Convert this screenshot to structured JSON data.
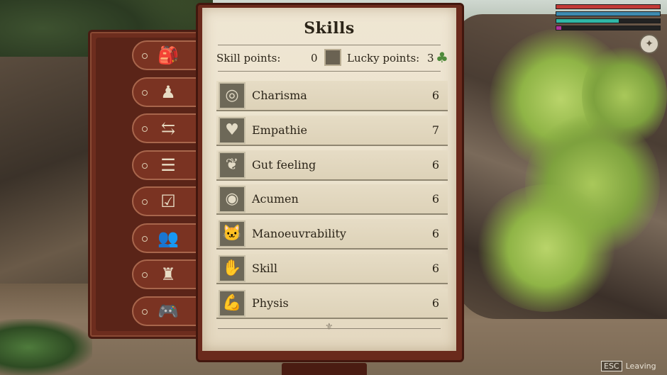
{
  "colors": {
    "health": "#c23a36",
    "stamina": "#3e8bb0",
    "energy": "#2fb7a6",
    "nourishment": "#b0319e",
    "paper": "#ebe2cd",
    "leather": "#6a2a1c"
  },
  "hud": {
    "bars": [
      {
        "name": "health-bar",
        "fill": 1.0
      },
      {
        "name": "stamina-bar",
        "fill": 1.0
      },
      {
        "name": "energy-bar",
        "fill": 0.6
      },
      {
        "name": "nourishment-bar",
        "fill": 0.05
      }
    ],
    "compass_icon": "compass-icon"
  },
  "tabs": [
    {
      "icon": "backpack-icon",
      "glyph": "🎒"
    },
    {
      "icon": "character-icon",
      "glyph": "♟"
    },
    {
      "icon": "signpost-icon",
      "glyph": "⇆"
    },
    {
      "icon": "checklist-icon",
      "glyph": "☰"
    },
    {
      "icon": "quest-checkmark-icon",
      "glyph": "☑"
    },
    {
      "icon": "group-icon",
      "glyph": "👥"
    },
    {
      "icon": "chef-icon",
      "glyph": "♜"
    },
    {
      "icon": "gamepad-icon",
      "glyph": "🎮"
    }
  ],
  "skills_panel": {
    "title": "Skills",
    "skill_points_label": "Skill points:",
    "skill_points_value": "0",
    "lucky_points_label": "Lucky points:",
    "lucky_points_value": "3",
    "skills": [
      {
        "name": "Charisma",
        "value": "6",
        "icon": "charisma-icon",
        "glyph": "◎"
      },
      {
        "name": "Empathie",
        "value": "7",
        "icon": "heart-icon",
        "glyph": "♥"
      },
      {
        "name": "Gut feeling",
        "value": "6",
        "icon": "stomach-icon",
        "glyph": "❦"
      },
      {
        "name": "Acumen",
        "value": "6",
        "icon": "eye-icon",
        "glyph": "◉"
      },
      {
        "name": "Manoeuvrability",
        "value": "6",
        "icon": "cat-icon",
        "glyph": "🐱"
      },
      {
        "name": "Skill",
        "value": "6",
        "icon": "hand-icon",
        "glyph": "✋"
      },
      {
        "name": "Physis",
        "value": "6",
        "icon": "muscle-icon",
        "glyph": "💪"
      }
    ]
  },
  "footer": {
    "esc_key": "ESC",
    "esc_label": "Leaving"
  }
}
